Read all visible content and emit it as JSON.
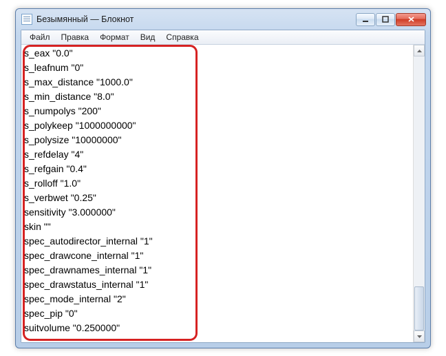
{
  "window": {
    "title": "Безымянный — Блокнот"
  },
  "menu": {
    "file": "Файл",
    "edit": "Правка",
    "format": "Формат",
    "view": "Вид",
    "help": "Справка"
  },
  "lines": [
    "s_eax \"0.0\"",
    "s_leafnum \"0\"",
    "s_max_distance \"1000.0\"",
    "s_min_distance \"8.0\"",
    "s_numpolys \"200\"",
    "s_polykeep \"1000000000\"",
    "s_polysize \"10000000\"",
    "s_refdelay \"4\"",
    "s_refgain \"0.4\"",
    "s_rolloff \"1.0\"",
    "s_verbwet \"0.25\"",
    "sensitivity \"3.000000\"",
    "skin \"\"",
    "spec_autodirector_internal \"1\"",
    "spec_drawcone_internal \"1\"",
    "spec_drawnames_internal \"1\"",
    "spec_drawstatus_internal \"1\"",
    "spec_mode_internal \"2\"",
    "spec_pip \"0\"",
    "suitvolume \"0.250000\""
  ]
}
